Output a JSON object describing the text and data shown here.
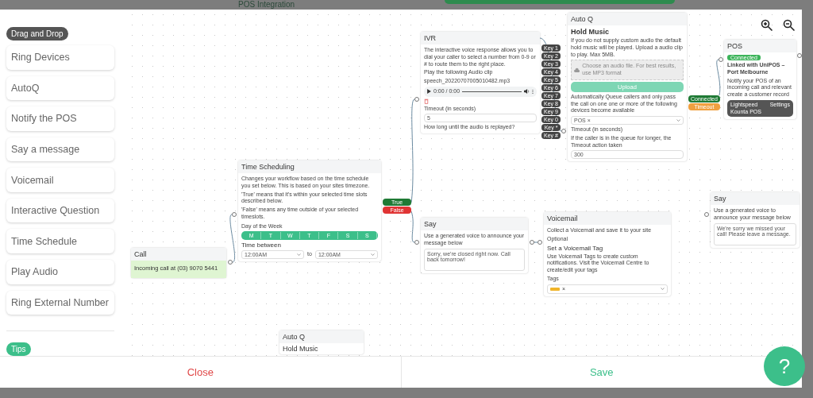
{
  "backdrop": {
    "title": "POS Integration"
  },
  "sidebar": {
    "heading": "Drag and Drop",
    "items": [
      "Ring Devices",
      "AutoQ",
      "Notify the POS",
      "Say a message",
      "Voicemail",
      "Interactive Question",
      "Time Schedule",
      "Play Audio",
      "Ring External Number"
    ],
    "tips": "Tips"
  },
  "call_node": {
    "title": "Call",
    "text": "Incoming call at (03) 9070 5441"
  },
  "time_node": {
    "title": "Time Scheduling",
    "lines": [
      "Changes your workflow based on the time schedule you set below. This is based on your sites timezone.",
      "'True' means that it's within your selected time slots described below.",
      "'False' means any time outside of your selected timeslots."
    ],
    "days_label": "Day of the Week",
    "days": [
      {
        "label": "M",
        "selected": true
      },
      {
        "label": "T",
        "selected": true
      },
      {
        "label": "W",
        "selected": true
      },
      {
        "label": "T",
        "selected": true
      },
      {
        "label": "F",
        "selected": true
      },
      {
        "label": "S",
        "selected": true
      },
      {
        "label": "S",
        "selected": true
      }
    ],
    "between_label": "Time between",
    "from": "12:00AM",
    "to_label": "to",
    "to": "12:00AM",
    "outputs": [
      {
        "label": "True",
        "color": "#1f7a35"
      },
      {
        "label": "False",
        "color": "#e03434"
      }
    ]
  },
  "ivr_node": {
    "title": "IVR",
    "text": "The interactive voice response allows you to dial your caller to select a number from 0-9 or # to route them to the right place.",
    "clip_label": "Play the following Audio clip",
    "clip": "speech_20220707005010482.mp3",
    "player_time": "0:00 / 0:00",
    "timeout_label": "Timeout (in seconds)",
    "timeout": "5",
    "timeout_hint": "How long until the audio is replayed?",
    "keys": [
      "Key 1",
      "Key 2",
      "Key 3",
      "Key 4",
      "Key 5",
      "Key 6",
      "Key 7",
      "Key 8",
      "Key 9",
      "Key 0",
      "Key *",
      "Key #"
    ]
  },
  "autoq_node": {
    "title": "Auto Q",
    "section": "Hold Music",
    "hint": "If you do not supply custom audio the default hold music will be played. Upload a audio clip to play. Max 5MB.",
    "file_placeholder": "Choose an audio file. For best results, use MP3 format",
    "upload": "Upload",
    "queue_text": "Automatically Queue callers and only pass the call on one one or more of the following devices become available",
    "device": "POS ×",
    "timeout_label": "Timeout (in seconds)",
    "timeout_hint": "If the caller is in the queue for longer, the Timeout action taken",
    "timeout": "300",
    "outputs": [
      {
        "label": "Connected",
        "color": "#1f7a35"
      },
      {
        "label": "Timeout",
        "color": "#f0a040"
      }
    ]
  },
  "pos_node": {
    "title": "POS",
    "status": "Connected",
    "linked": "Linked with UniPOS – Port Melbourne",
    "text": "Notify your POS of an incoming call and relevant create a customer record",
    "integration": "Lightspeed Kounta POS",
    "settings": "Settings"
  },
  "say_node": {
    "title": "Say",
    "text": "Use a generated voice to announce your message below",
    "message": "Sorry, we're closed right now. Call back tomorrow!"
  },
  "voicemail_node": {
    "title": "Voicemail",
    "text": "Collect a Voicemail and save it to your site",
    "optional": "Optional",
    "tag_heading": "Set a Voicemail Tag",
    "tag_hint": "Use Voicemail Tags to create custom notifications. Visit the Voicemail Centre to create/edit your tags",
    "tags_label": "Tags",
    "tag_remove": "×"
  },
  "say_node_right": {
    "title": "Say",
    "text": "Use a generated voice to announce your message below",
    "message": "We're sorry we missed your call! Please leave a message."
  },
  "autoq_node_lower": {
    "title": "Auto Q",
    "section": "Hold Music"
  },
  "footer": {
    "close": "Close",
    "save": "Save"
  },
  "help": "?"
}
